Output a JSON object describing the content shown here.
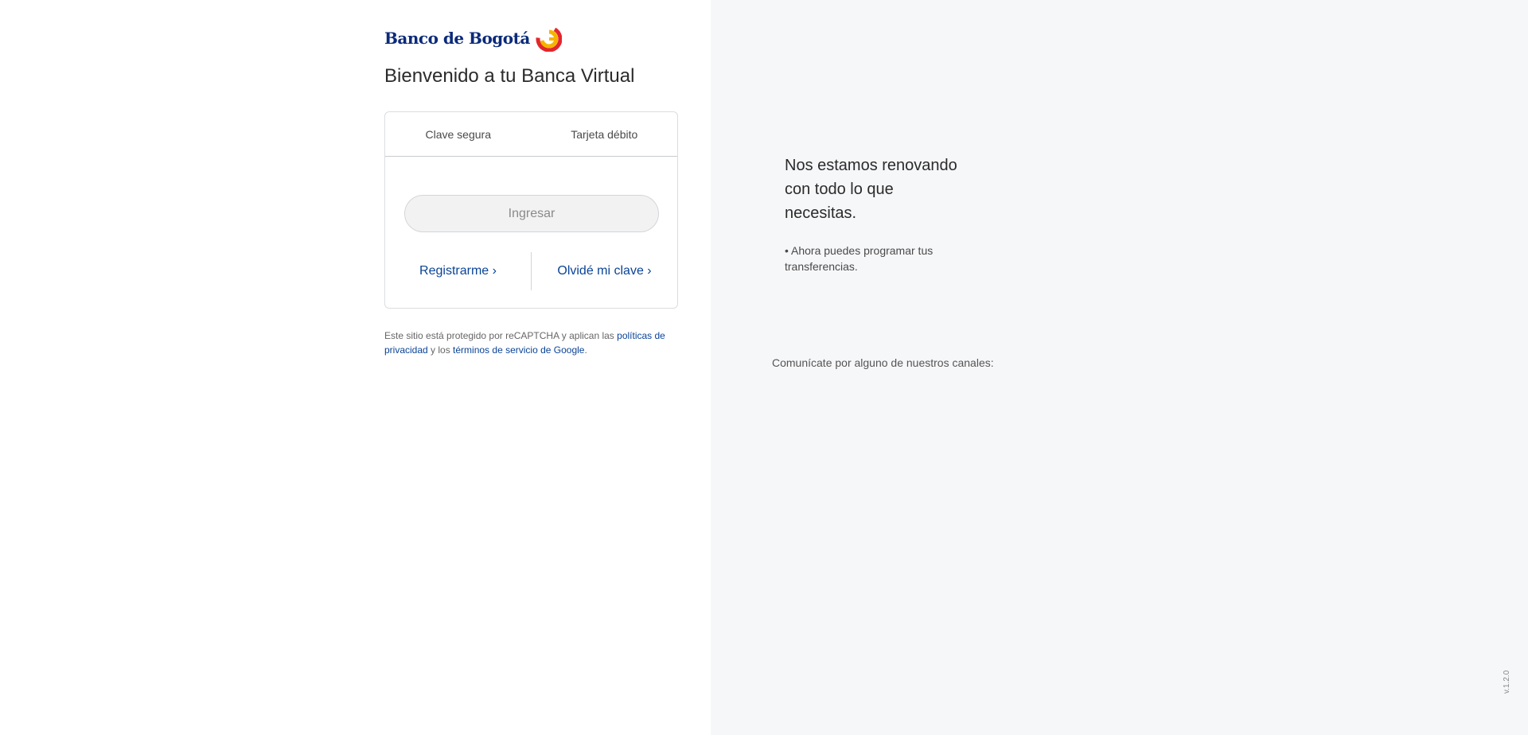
{
  "brand": {
    "name": "Banco de Bogotá",
    "logo_icon": "banco-de-bogota-g-logo"
  },
  "welcome_title": "Bienvenido a tu Banca Virtual",
  "login_card": {
    "tabs": [
      {
        "label": "Clave segura"
      },
      {
        "label": "Tarjeta débito"
      }
    ],
    "ingresar_label": "Ingresar",
    "register_label": "Registrarme ›",
    "forgot_label": "Olvidé mi clave ›"
  },
  "recaptcha": {
    "text_before": "Este sitio está protegido por reCAPTCHA y aplican las ",
    "privacy_link": "políticas de privacidad",
    "text_middle": " y los ",
    "terms_link": "términos de servicio de Google",
    "text_after": "."
  },
  "promo": {
    "title": "Nos estamos renovando con todo lo que necesitas.",
    "bullet": "• Ahora puedes programar tus transferencias."
  },
  "channels_label": "Comunícate por alguno de nuestros canales:",
  "version": "v.1.2.0",
  "colors": {
    "brand_blue": "#0b2a7a",
    "link_blue": "#0a4396",
    "logo_red": "#e3262c",
    "logo_yellow": "#f6b400",
    "panel_gray": "#f6f7f9"
  }
}
